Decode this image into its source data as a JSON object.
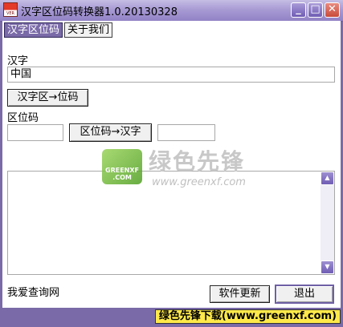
{
  "window": {
    "title": "汉字区位码转换器1.0.20130328",
    "icon_label": "VER",
    "controls": {
      "minimize": "_",
      "maximize": "□",
      "close": "✕"
    }
  },
  "tabs": [
    {
      "label": "汉字区位码",
      "active": true
    },
    {
      "label": "关于我们",
      "active": false
    }
  ],
  "hanzi_section": {
    "label": "汉字",
    "value": "中国",
    "convert_button": "汉字区→位码"
  },
  "code_section": {
    "label": "区位码",
    "input_value": "",
    "convert_button": "区位码→汉字",
    "output_value": ""
  },
  "output_area": {
    "value": ""
  },
  "watermark": {
    "title": "绿色先锋",
    "url": "www.greenxf.com",
    "logo_text": "GREENXF .COM"
  },
  "footer": {
    "link_text": "我爱查询网",
    "update_button": "软件更新",
    "exit_button": "退出"
  },
  "status_banner": "绿色先锋下载(www.greenxf.com)",
  "colors": {
    "accent": "#7a6aa8",
    "banner": "#ffe94a"
  }
}
